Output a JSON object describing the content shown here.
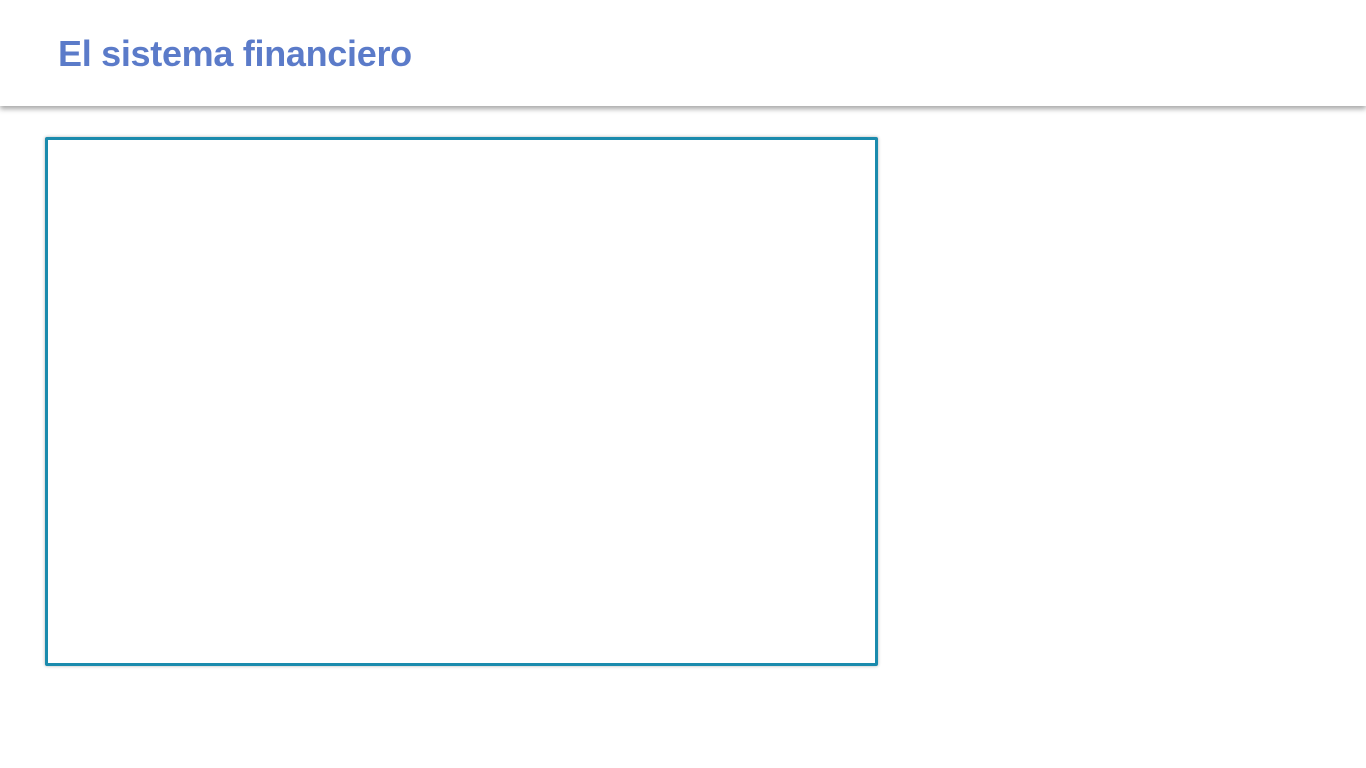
{
  "slide": {
    "title": "El sistema financiero"
  },
  "colors": {
    "title": "#5b7bc9",
    "frame_border": "#1b8bad",
    "background": "#ffffff"
  }
}
